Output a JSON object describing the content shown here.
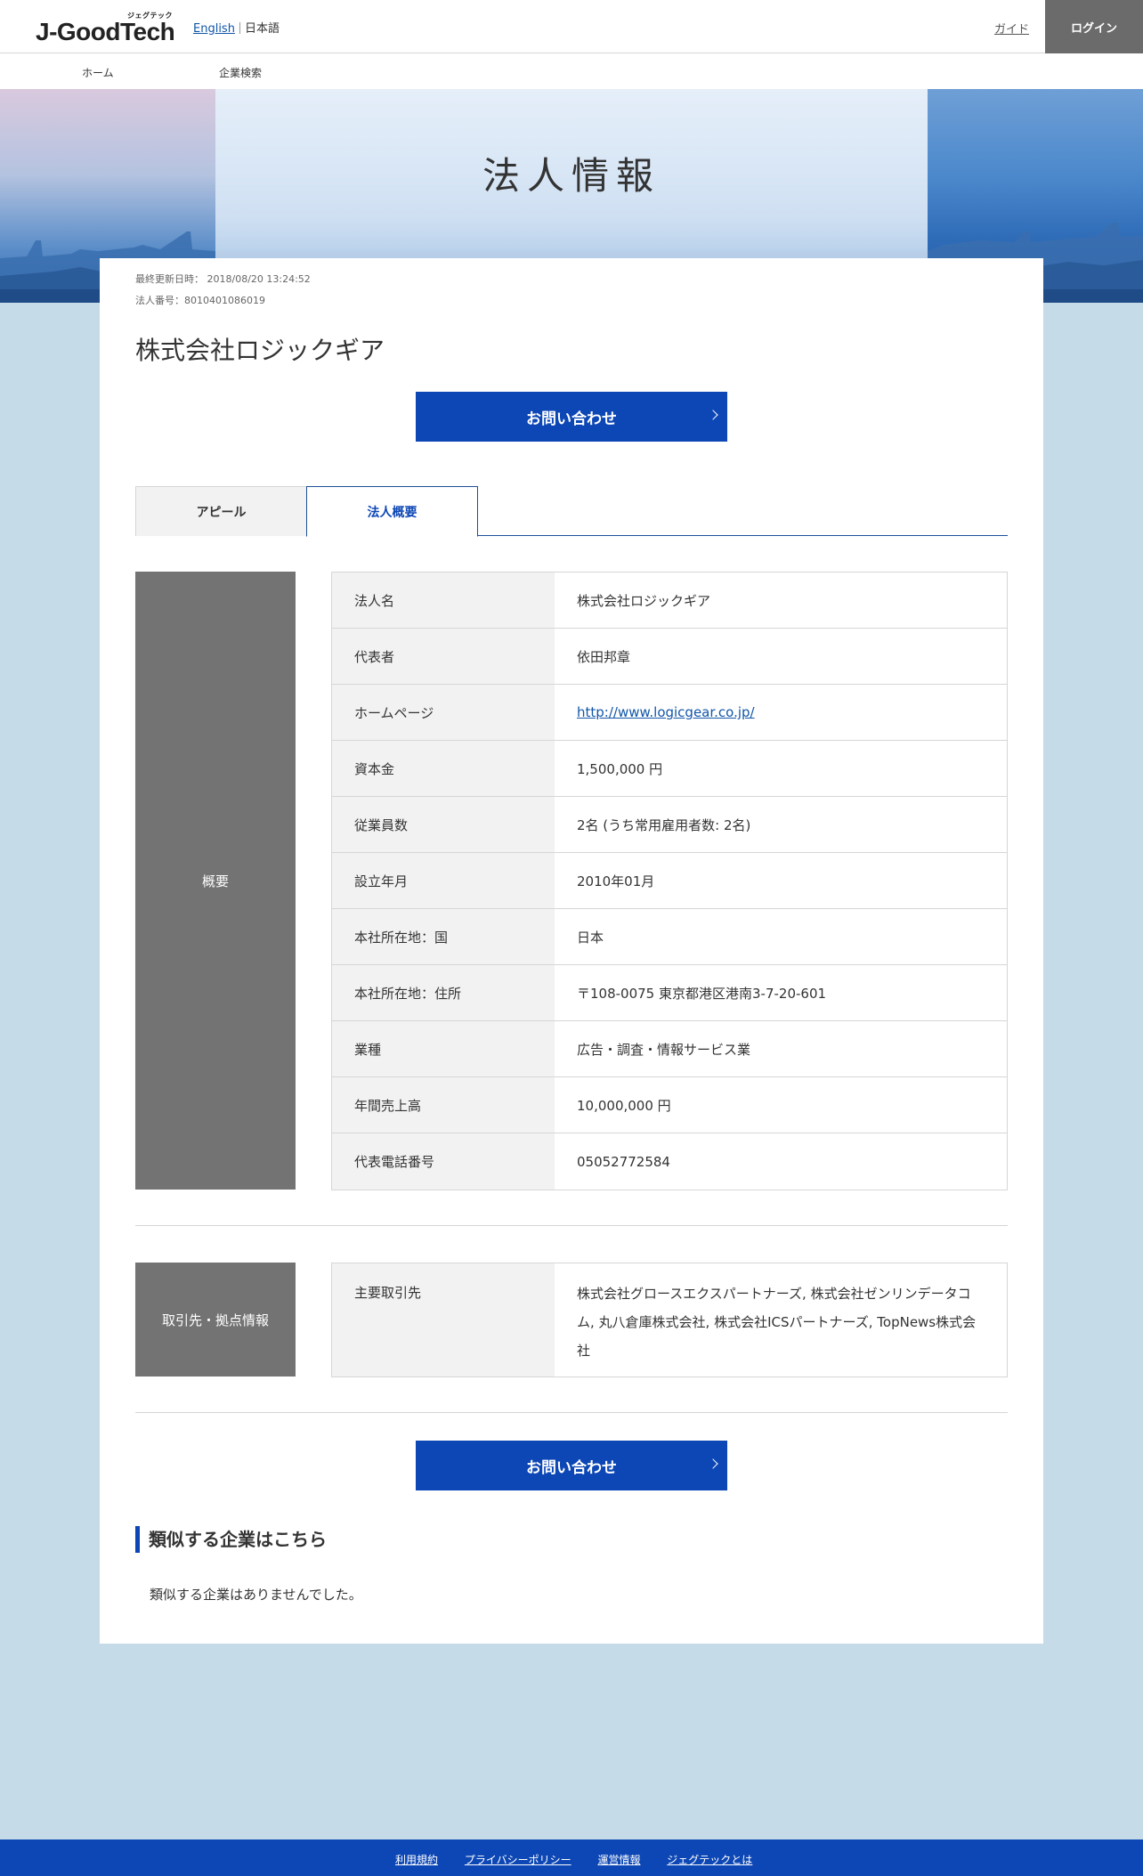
{
  "header": {
    "logo_text": "J-GoodTech",
    "logo_sub": "ジェグテック",
    "lang_english": "English",
    "lang_japanese": "日本語",
    "guide_label": "ガイド",
    "login_label": "ログイン"
  },
  "nav": {
    "home": "ホーム",
    "company_search": "企業検索"
  },
  "hero": {
    "title": "法人情報"
  },
  "company": {
    "last_updated": "最終更新日時： 2018/08/20 13:24:52",
    "corporate_number": "法人番号：8010401086019",
    "name": "株式会社ロジックギア"
  },
  "cta": {
    "label": "お問い合わせ"
  },
  "tabs": [
    {
      "label": "アピール",
      "active": false
    },
    {
      "label": "法人概要",
      "active": true
    }
  ],
  "overview": {
    "section_label": "概要",
    "rows": [
      {
        "key": "法人名",
        "value": "株式会社ロジックギア"
      },
      {
        "key": "代表者",
        "value": "依田邦章"
      },
      {
        "key": "ホームページ",
        "value": "http://www.logicgear.co.jp/"
      },
      {
        "key": "資本金",
        "value": "1,500,000 円"
      },
      {
        "key": "従業員数",
        "value": "2名 (うち常用雇用者数: 2名)"
      },
      {
        "key": "設立年月",
        "value": "2010年01月"
      },
      {
        "key": "本社所在地：国",
        "value": "日本"
      },
      {
        "key": "本社所在地：住所",
        "value": "〒108-0075 東京都港区港南3-7-20-601"
      },
      {
        "key": "業種",
        "value": "広告・調査・情報サービス業"
      },
      {
        "key": "年間売上高",
        "value": "10,000,000 円"
      },
      {
        "key": "代表電話番号",
        "value": "05052772584"
      }
    ]
  },
  "partners": {
    "section_label": "取引先・拠点情報",
    "rows": [
      {
        "key": "主要取引先",
        "value": "株式会社グロースエクスパートナーズ, 株式会社ゼンリンデータコム, 丸八倉庫株式会社, 株式会社ICSパートナーズ, TopNews株式会社"
      }
    ]
  },
  "similar": {
    "heading": "類似する企業はこちら",
    "empty_text": "類似する企業はありませんでした。"
  },
  "footer": {
    "links": [
      "利用規約",
      "プライバシーポリシー",
      "運営情報",
      "ジェグテックとは"
    ]
  },
  "colors": {
    "primary_blue": "#0d47b5",
    "label_gray": "#737373",
    "page_bg": "#c6dbe8",
    "logo_accent": "#e2003d"
  }
}
